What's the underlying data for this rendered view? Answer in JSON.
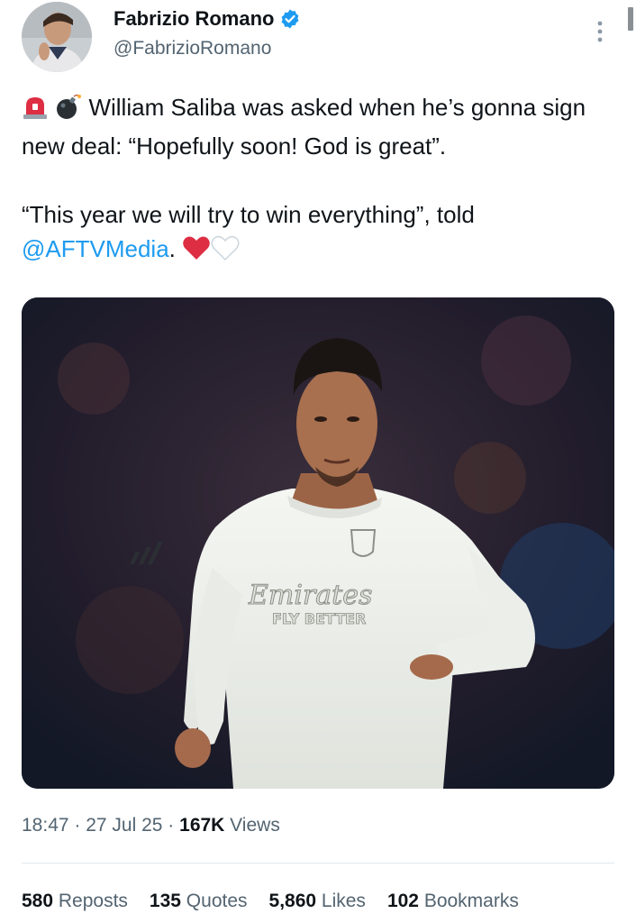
{
  "author": {
    "display_name": "Fabrizio Romano",
    "handle": "@FabrizioRomano",
    "verified_icon": "verified-badge-icon"
  },
  "tweet": {
    "line1_text": "William Saliba was asked when he’s gonna sign new deal: “Hopefully soon! God is great”.",
    "line2_text": "“This year we will try to win everything”, told ",
    "mention": "@AFTVMedia",
    "line2_end": ".",
    "emojis_start": [
      "siren-emoji",
      "bomb-emoji"
    ],
    "emojis_end": [
      "red-heart-emoji",
      "white-heart-emoji"
    ]
  },
  "media": {
    "shirt_sponsor": "Emirates",
    "shirt_slogan": "FLY BETTER"
  },
  "meta": {
    "time": "18:47",
    "sep1": " · ",
    "date": "27 Jul 25",
    "sep2": " · ",
    "views_count": "167K",
    "views_label": " Views"
  },
  "stats": {
    "reposts_count": "580",
    "reposts_label": " Reposts",
    "quotes_count": "135",
    "quotes_label": " Quotes",
    "likes_count": "5,860",
    "likes_label": " Likes",
    "bookmarks_count": "102",
    "bookmarks_label": " Bookmarks"
  },
  "colors": {
    "link": "#1d9bf0",
    "secondary_text": "#536471",
    "primary_text": "#0f1419"
  }
}
